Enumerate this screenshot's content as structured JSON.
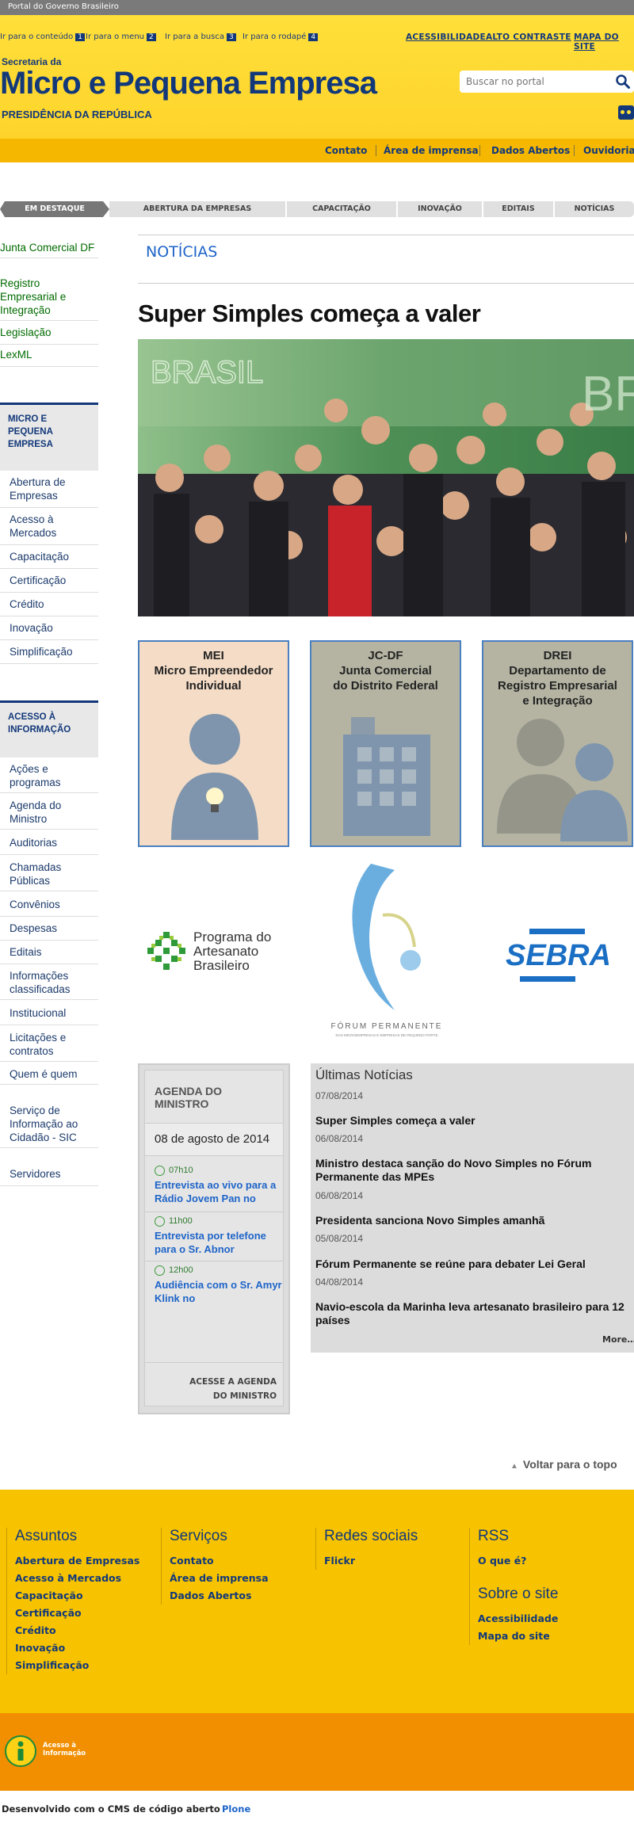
{
  "govbar": {
    "label": "Portal do Governo Brasileiro"
  },
  "skiplinks": [
    {
      "label": "Ir para o conteúdo",
      "key": "1"
    },
    {
      "label": "Ir para o menu",
      "key": "2"
    },
    {
      "label": "Ir para a busca",
      "key": "3"
    },
    {
      "label": "Ir para o rodapé",
      "key": "4"
    }
  ],
  "toplinks": [
    "ACESSIBILIDADE",
    "ALTO CONTRASTE",
    "MAPA DO SITE"
  ],
  "header": {
    "secretaria": "Secretaria da",
    "title": "Micro e Pequena Empresa",
    "presidencia": "PRESIDÊNCIA DA REPÚBLICA"
  },
  "search": {
    "placeholder": "Buscar no portal"
  },
  "service_links": [
    "Contato",
    "Área de imprensa",
    "Dados Abertos",
    "Ouvidoria"
  ],
  "tabs": [
    "EM DESTAQUE",
    "ABERTURA DA EMPRESAS",
    "CAPACITAÇÃO",
    "INOVAÇÃO",
    "EDITAIS",
    "NOTÍCIAS"
  ],
  "left_top_links": [
    "Junta Comercial DF",
    "Registro Empresarial e Integração",
    "Legislação",
    "LexML"
  ],
  "menu_mpe": {
    "heading": "MICRO E PEQUENA EMPRESA",
    "items": [
      "Abertura de Empresas",
      "Acesso à Mercados",
      "Capacitação",
      "Certificação",
      "Crédito",
      "Inovação",
      "Simplificação"
    ]
  },
  "menu_acesso": {
    "heading": "ACESSO À INFORMAÇÃO",
    "items": [
      "Ações e programas",
      "Agenda do Ministro",
      "Auditorias",
      "Chamadas Públicas",
      "Convênios",
      "Despesas",
      "Editais",
      "Informações classificadas",
      "Institucional",
      "Licitações e contratos",
      "Quem é quem",
      "Serviço de Informação ao Cidadão - SIC",
      "Servidores"
    ]
  },
  "news_heading": "NOTÍCIAS",
  "headline": "Super Simples começa a valer",
  "photo_text": {
    "wall": "BRASIL",
    "wall2": "BR"
  },
  "cards": [
    {
      "lines": [
        "MEI",
        "Micro Empreendedor",
        "Individual"
      ],
      "bg": "#f4dcc6"
    },
    {
      "lines": [
        "JC-DF",
        "Junta Comercial",
        "do Distrito Federal"
      ],
      "bg": "#b5b4a3"
    },
    {
      "lines": [
        "DREI",
        "Departamento de",
        "Registro Empresarial",
        "e Integração"
      ],
      "bg": "#b5b4a3"
    }
  ],
  "logos": {
    "artesanato": [
      "Programa do",
      "Artesanato",
      "Brasileiro"
    ],
    "forum": "FÓRUM PERMANENTE",
    "forum_sub": "DAS MICROEMPRESAS E EMPRESAS DE PEQUENO PORTE",
    "sebrae": "SEBRAE"
  },
  "agenda": {
    "title": "AGENDA DO MINISTRO",
    "date": "08 de agosto de 2014",
    "items": [
      {
        "time": "07h10",
        "text": "Entrevista ao vivo para a Rádio Jovem Pan no"
      },
      {
        "time": "11h00",
        "text": "Entrevista por telefone para o Sr. Abnor"
      },
      {
        "time": "12h00",
        "text": "Audiência com o Sr. Amyr Klink no"
      }
    ],
    "link": "ACESSE A AGENDA DO MINISTRO"
  },
  "ultimas": {
    "title": "Últimas Notícias",
    "items": [
      {
        "date": "07/08/2014",
        "title": "Super Simples começa a valer"
      },
      {
        "date": "06/08/2014",
        "title": "Ministro destaca sanção do Novo Simples no Fórum Permanente das MPEs"
      },
      {
        "date": "06/08/2014",
        "title": "Presidenta sanciona Novo Simples amanhã"
      },
      {
        "date": "05/08/2014",
        "title": "Fórum Permanente se reúne para debater Lei Geral"
      },
      {
        "date": "04/08/2014",
        "title": "Navio-escola da Marinha leva artesanato brasileiro para 12 países"
      }
    ],
    "more": "More…"
  },
  "voltar": "Voltar para o topo",
  "footer": {
    "assuntos": {
      "title": "Assuntos",
      "items": [
        "Abertura de Empresas",
        "Acesso à Mercados",
        "Capacitação",
        "Certificação",
        "Crédito",
        "Inovação",
        "Simplificação"
      ]
    },
    "servicos": {
      "title": "Serviços",
      "items": [
        "Contato",
        "Área de imprensa",
        "Dados Abertos"
      ]
    },
    "redes": {
      "title": "Redes sociais",
      "items": [
        "Flickr"
      ]
    },
    "rss": {
      "title": "RSS",
      "items": [
        "O que é?"
      ]
    },
    "sobre": {
      "title": "Sobre o site",
      "items": [
        "Acessibilidade",
        "Mapa do site"
      ]
    }
  },
  "acesso_logo": [
    "Acesso à",
    "Informação"
  ],
  "bottom": {
    "text": "Desenvolvido com o CMS de código aberto",
    "link": "Plone"
  },
  "colors": {
    "navy": "#12387a",
    "yellow": "#fed42b",
    "orange": "#f18f00",
    "link_blue": "#1e64c8"
  }
}
